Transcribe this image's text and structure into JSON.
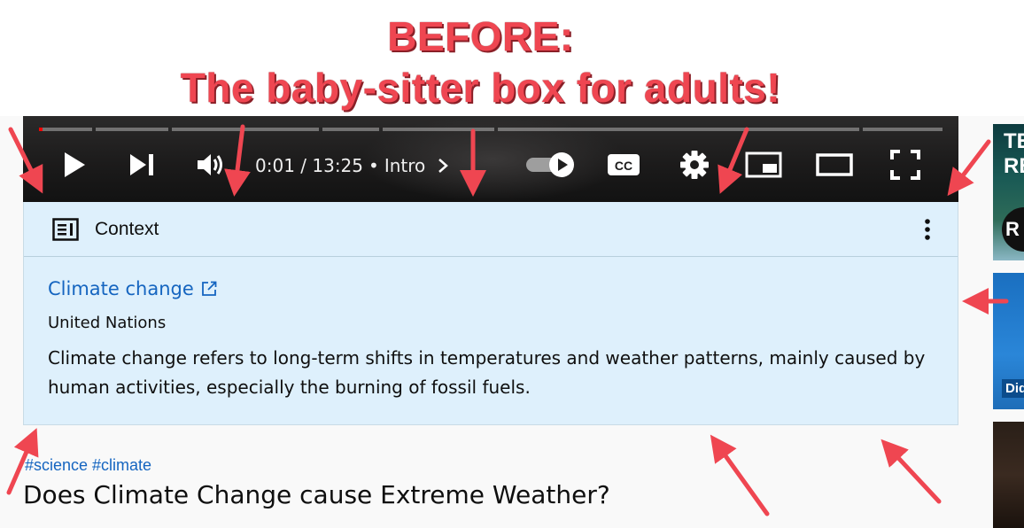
{
  "annotation": {
    "line1": "BEFORE:",
    "line2": "The baby-sitter box for adults!",
    "color": "#ef4651"
  },
  "player": {
    "time_display": "0:01 / 13:25",
    "chapter": "Intro",
    "progress_fraction": 0.0013,
    "controls": [
      "play-icon",
      "next-icon",
      "volume-icon",
      "autoplay-toggle",
      "captions-icon",
      "settings-icon",
      "miniplayer-icon",
      "theater-icon",
      "fullscreen-icon"
    ],
    "captions_label": "CC"
  },
  "context_panel": {
    "header": "Context",
    "link_text": "Climate change",
    "source": "United Nations",
    "body": "Climate change refers to long-term shifts in temperatures and weather patterns, mainly caused by human activities, especially the burning of fossil fuels.",
    "background": "#def0fc",
    "link_color": "#1565c0"
  },
  "video": {
    "tags": "#science #climate",
    "title": "Does Climate Change cause Extreme Weather?"
  },
  "sidebar": {
    "thumb1_text": "TE\nRE",
    "thumb1_letter": "R",
    "thumb2_text": "Did"
  }
}
